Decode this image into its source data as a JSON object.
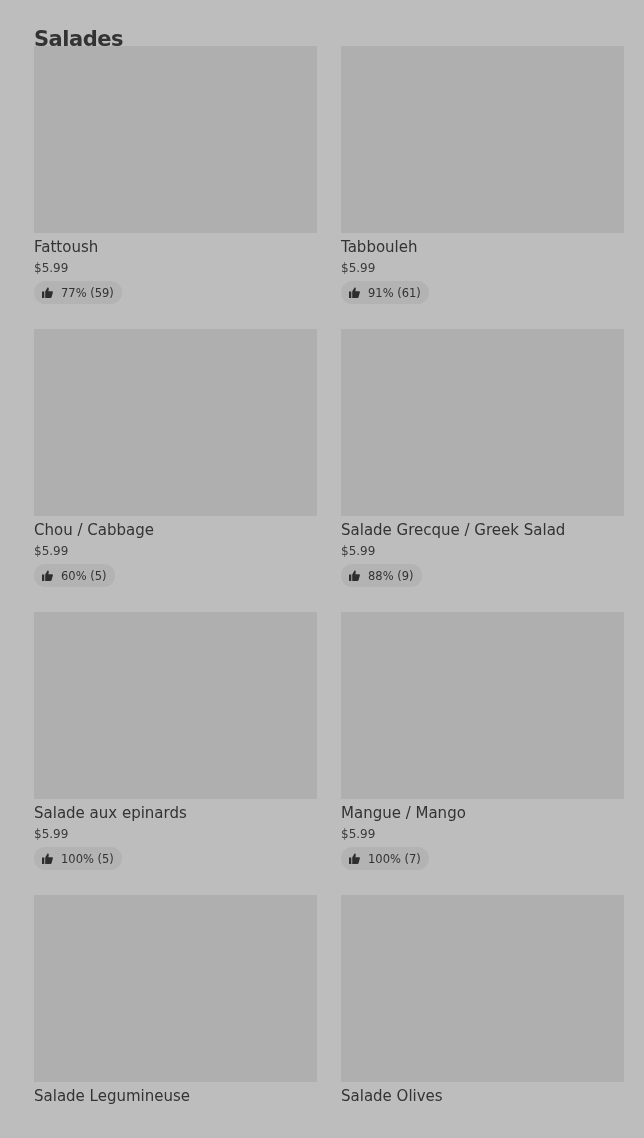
{
  "section": {
    "title": "Salades"
  },
  "items": [
    {
      "name": "Fattoush",
      "price": "$5.99",
      "rating": "77% (59)"
    },
    {
      "name": "Tabbouleh",
      "price": "$5.99",
      "rating": "91% (61)"
    },
    {
      "name": "Chou / Cabbage",
      "price": "$5.99",
      "rating": "60% (5)"
    },
    {
      "name": "Salade Grecque / Greek Salad",
      "price": "$5.99",
      "rating": "88% (9)"
    },
    {
      "name": "Salade aux epinards",
      "price": "$5.99",
      "rating": "100% (5)"
    },
    {
      "name": "Mangue / Mango",
      "price": "$5.99",
      "rating": "100% (7)"
    },
    {
      "name": "Salade Legumineuse"
    },
    {
      "name": "Salade Olives"
    }
  ]
}
